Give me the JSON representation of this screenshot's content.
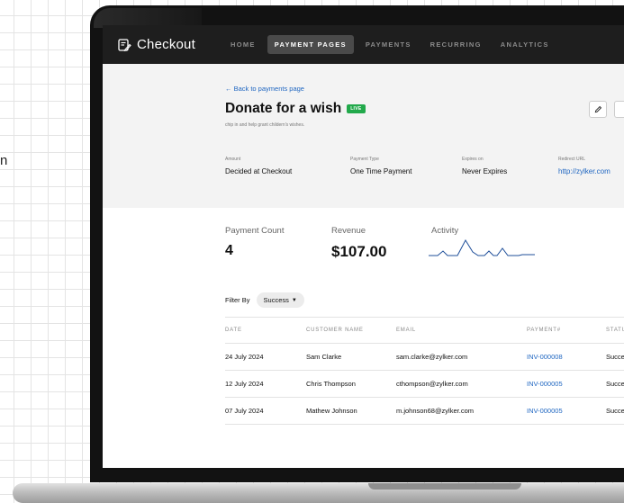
{
  "page": {
    "side_letter": "n"
  },
  "app": {
    "name": "Checkout",
    "logo_icon": "checkout-logo-icon"
  },
  "nav": {
    "items": [
      {
        "label": "HOME",
        "active": false
      },
      {
        "label": "PAYMENT PAGES",
        "active": true
      },
      {
        "label": "PAYMENTS",
        "active": false
      },
      {
        "label": "RECURRING",
        "active": false
      },
      {
        "label": "ANALYTICS",
        "active": false
      }
    ]
  },
  "header": {
    "back_link": "← Back to payments page",
    "title": "Donate for a wish",
    "badge": "LIVE",
    "subtitle": "chip in and help grant childern's wishes.",
    "edit_icon": "pencil-icon"
  },
  "details": {
    "amount": {
      "label": "Amount",
      "value": "Decided at Checkout"
    },
    "payment_type": {
      "label": "Payment Type",
      "value": "One Time Payment"
    },
    "expires_on": {
      "label": "Expires on",
      "value": "Never Expires"
    },
    "redirect_url": {
      "label": "Redirect URL",
      "value": "http://zylker.com"
    }
  },
  "stats": {
    "payment_count": {
      "label": "Payment Count",
      "value": "4"
    },
    "revenue": {
      "label": "Revenue",
      "value": "$107.00"
    },
    "activity": {
      "label": "Activity"
    }
  },
  "filter": {
    "label": "Filter By",
    "value": "Success"
  },
  "table": {
    "columns": [
      "DATE",
      "CUSTOMER NAME",
      "EMAIL",
      "PAYMENT#",
      "STATUS"
    ],
    "rows": [
      {
        "date": "24 July 2024",
        "customer": "Sam Clarke",
        "email": "sam.clarke@zylker.com",
        "payment": "INV-000008",
        "status": "Success"
      },
      {
        "date": "12 July 2024",
        "customer": "Chris Thompson",
        "email": "cthompson@zylker.com",
        "payment": "INV-000005",
        "status": "Success"
      },
      {
        "date": "07 July 2024",
        "customer": "Mathew Johnson",
        "email": "m.johnson68@zylker.com",
        "payment": "INV-000005",
        "status": "Success"
      }
    ]
  },
  "colors": {
    "topbar": "#1e1e1e",
    "link": "#1f66c1",
    "live_badge": "#22a94b",
    "hero_bg": "#f3f3f3"
  }
}
